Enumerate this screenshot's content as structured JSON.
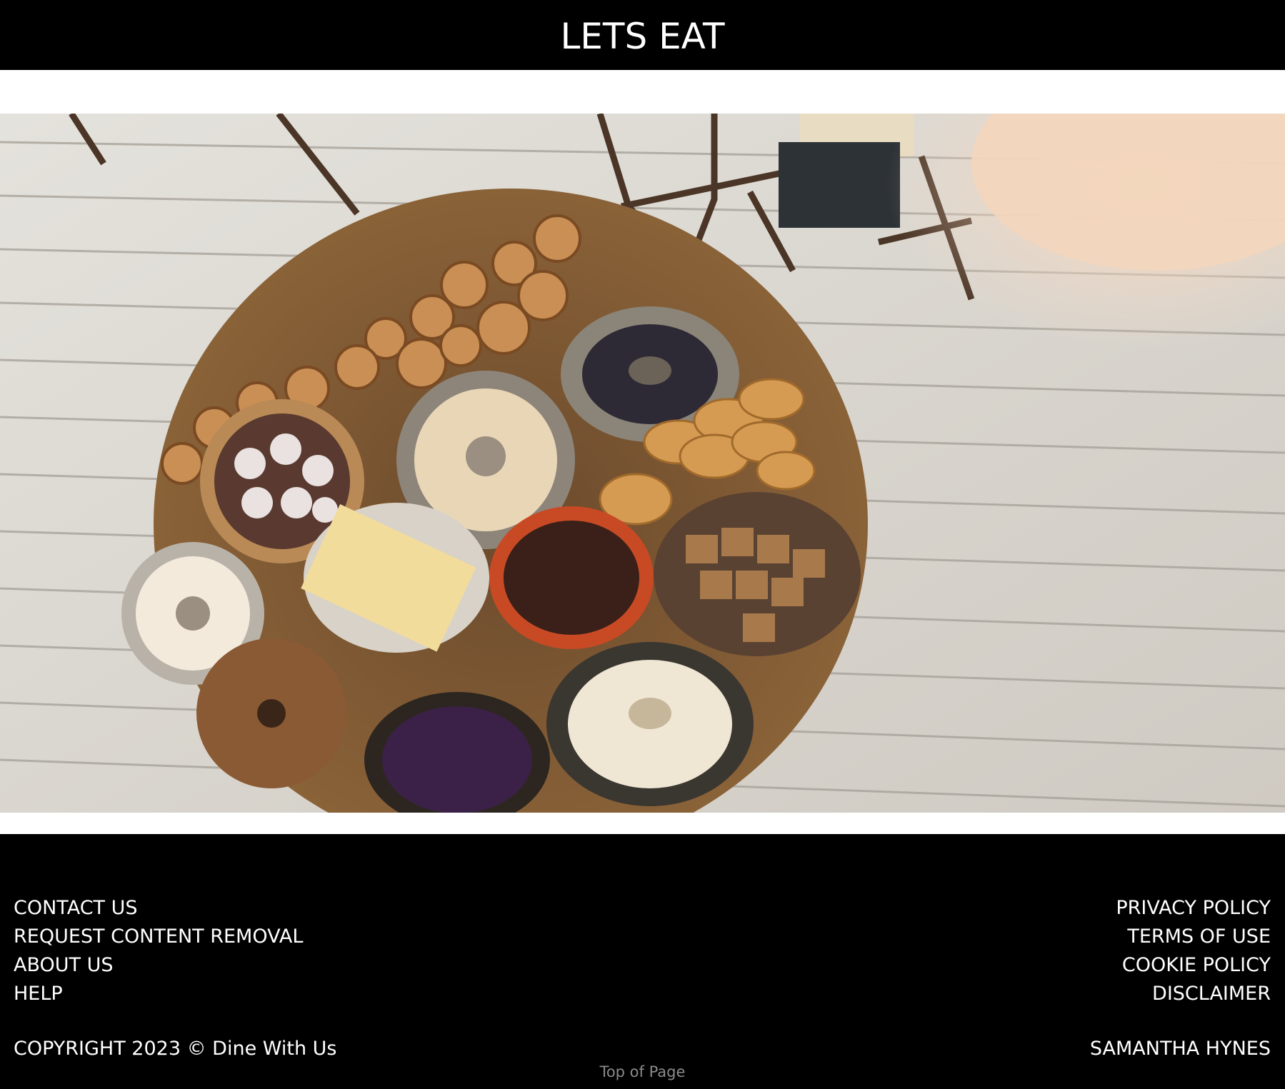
{
  "header": {
    "title": "LETS EAT"
  },
  "hero": {
    "image_name": "dessert-table-photo"
  },
  "footer": {
    "left_links": [
      {
        "label": "CONTACT US"
      },
      {
        "label": "REQUEST CONTENT REMOVAL"
      },
      {
        "label": "ABOUT US"
      },
      {
        "label": "HELP"
      }
    ],
    "right_links": [
      {
        "label": "PRIVACY POLICY"
      },
      {
        "label": "TERMS OF USE"
      },
      {
        "label": "COOKIE POLICY"
      },
      {
        "label": "DISCLAIMER"
      }
    ],
    "copyright": "COPYRIGHT 2023 © Dine With Us",
    "author": "SAMANTHA HYNES",
    "top_of_page": "Top of Page"
  },
  "colors": {
    "header_bg": "#000000",
    "footer_bg": "#000000",
    "text": "#ffffff",
    "muted_link": "#8a8a8a"
  }
}
